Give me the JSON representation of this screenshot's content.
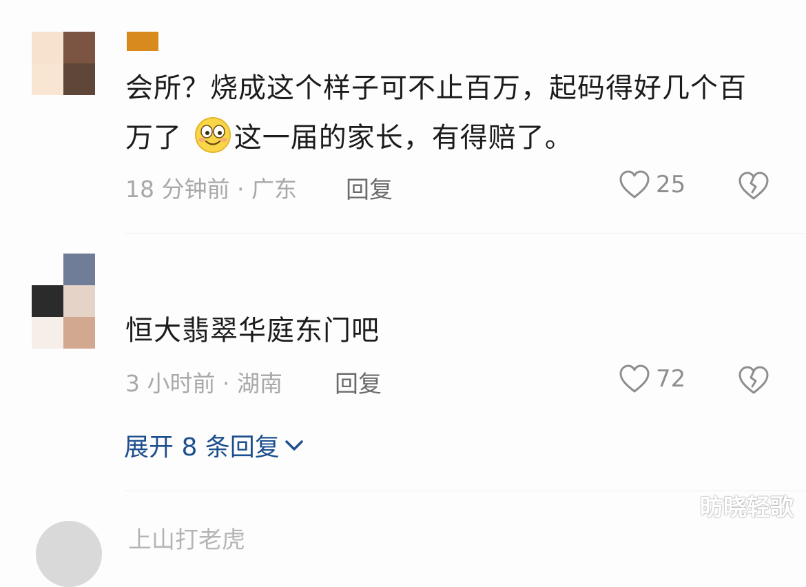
{
  "comments": [
    {
      "text_part1": "会所？烧成这个样子可不止百万，起码得好几个百万了",
      "emoji": "smiling-face-emoji",
      "text_part2": "这一届的家长，有得赔了。",
      "time": "18 分钟前",
      "location": "广东",
      "reply_label": "回复",
      "likes": "25"
    },
    {
      "text": "恒大翡翠华庭东门吧",
      "time": "3 小时前",
      "location": "湖南",
      "reply_label": "回复",
      "likes": "72"
    }
  ],
  "expand_label": "展开 8 条回复",
  "next_comment_name": "上山打老虎",
  "watermark": "昉晓轻歌",
  "colors": {
    "accent_link": "#1d4f8e",
    "meta_gray": "#a8a8a8",
    "name_bar": "#d98a1c"
  },
  "icons": {
    "like": "heart-outline-icon",
    "dislike": "broken-heart-icon",
    "expand": "chevron-down-icon"
  }
}
